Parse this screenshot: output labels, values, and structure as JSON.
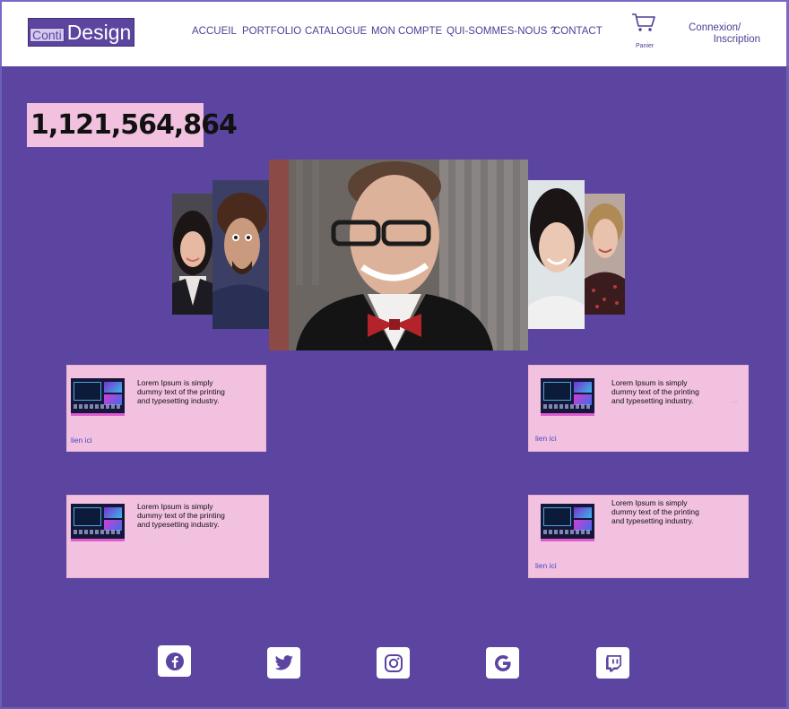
{
  "header": {
    "logo": {
      "part1": "Conti",
      "part2": "Design"
    },
    "nav": [
      {
        "id": "accueil",
        "label": "ACCUEIL"
      },
      {
        "id": "portfolio",
        "label": "PORTFOLIO"
      },
      {
        "id": "catalogue",
        "label": "CATALOGUE"
      },
      {
        "id": "mon-compte",
        "label": "MON COMPTE"
      },
      {
        "id": "qui-sommes-nous",
        "label": "QUI-SOMMES-NOUS ?"
      },
      {
        "id": "contact",
        "label": "CONTACT"
      }
    ],
    "cart_label": "Panier",
    "auth_line1": "Connexion/",
    "auth_line2": "Inscription"
  },
  "counter": {
    "value": "1,121,564,864"
  },
  "carousel": {
    "photos": [
      "woman-dark-hair",
      "man-curly-hair",
      "man-bow-tie",
      "woman-smiling",
      "woman-blonde"
    ]
  },
  "cards": [
    {
      "text": "Lorem Ipsum is simply dummy text of the printing and typesetting industry.",
      "link": "lien ici",
      "ellipsis": ""
    },
    {
      "text": "Lorem Ipsum is simply dummy text of the printing and typesetting industry.",
      "link": "lien ici",
      "ellipsis": "..."
    },
    {
      "text": "Lorem Ipsum is simply dummy text of the printing and typesetting industry.",
      "link": "",
      "ellipsis": ""
    },
    {
      "text": "Lorem Ipsum is simply dummy text of the printing and typesetting industry.",
      "link": "lien ici",
      "ellipsis": ""
    }
  ],
  "social": [
    {
      "icon": "facebook-icon"
    },
    {
      "icon": "twitter-icon"
    },
    {
      "icon": "instagram-icon"
    },
    {
      "icon": "google-icon"
    },
    {
      "icon": "twitch-icon"
    }
  ],
  "colors": {
    "background": "#5b45a0",
    "card": "#f1c1df",
    "nav_text": "#4f3d94"
  }
}
